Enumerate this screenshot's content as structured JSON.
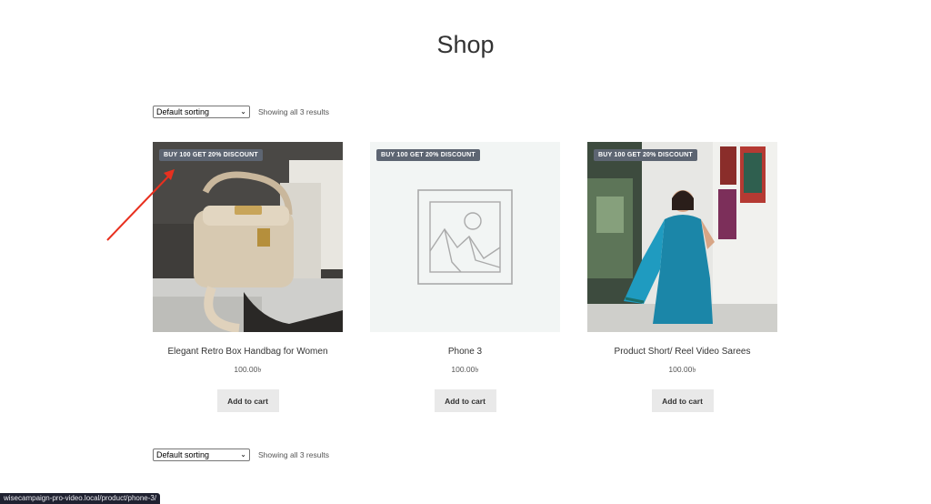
{
  "page": {
    "title": "Shop"
  },
  "toolbar": {
    "sort_label": "Default sorting",
    "result_count": "Showing all 3 results"
  },
  "products": [
    {
      "badge": "BUY 100 GET 20% DISCOUNT",
      "title": "Elegant Retro Box Handbag for Women",
      "price": "100.00৳",
      "button": "Add to cart",
      "image": "handbag-photo"
    },
    {
      "badge": "BUY 100 GET 20% DISCOUNT",
      "title": "Phone 3",
      "price": "100.00৳",
      "button": "Add to cart",
      "image": "placeholder-image-icon"
    },
    {
      "badge": "BUY 100 GET 20% DISCOUNT",
      "title": "Product Short/ Reel Video Sarees",
      "price": "100.00৳",
      "button": "Add to cart",
      "image": "saree-photo"
    }
  ],
  "status_bar": {
    "url": "wisecampaign-pro-video.local/product/phone-3/"
  },
  "colors": {
    "badge_bg": "#5d6572",
    "button_bg": "#e9e9e9",
    "annotation_arrow": "#e8301f"
  }
}
